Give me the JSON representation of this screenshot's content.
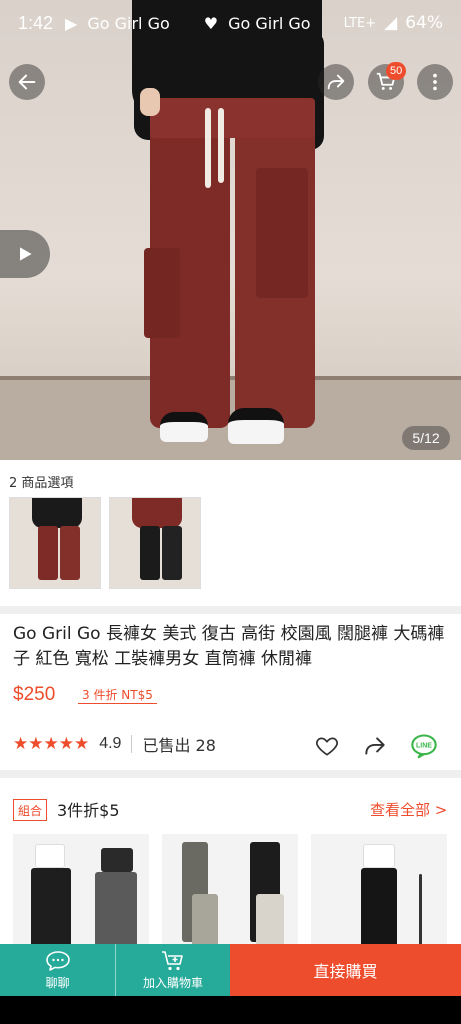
{
  "status_bar": {
    "time": "1:42",
    "notif_text": "Go Girl Go",
    "notif_text_2": "Go Girl Go",
    "network": "LTE+",
    "battery": "64%"
  },
  "header": {
    "back_icon": "arrow-left-icon",
    "share_icon": "share-icon",
    "cart_icon": "cart-icon",
    "cart_count": "50",
    "more_icon": "more-vertical-icon"
  },
  "gallery": {
    "counter": "5/12",
    "video_icon": "play-icon"
  },
  "variations": {
    "label": "2 商品選項"
  },
  "product": {
    "title": "Go Gril Go 長褲女 美式 復古 高街 校園風 闊腿褲 大碼褲子 紅色 寬松 工裝褲男女 直筒褲 休閒褲",
    "price": "$250",
    "promo": "3 件折 NT$5",
    "stars": "★★★★★",
    "rating": "4.9",
    "sold": "已售出 28"
  },
  "bundle": {
    "tag": "組合",
    "title": "3件折$5",
    "see_all": "查看全部 >"
  },
  "bottom_bar": {
    "chat_label": "聊聊",
    "add_cart_label": "加入購物車",
    "buy_label": "直接購買"
  },
  "colors": {
    "brand": "#ee4d2d",
    "teal": "#26aa99"
  }
}
